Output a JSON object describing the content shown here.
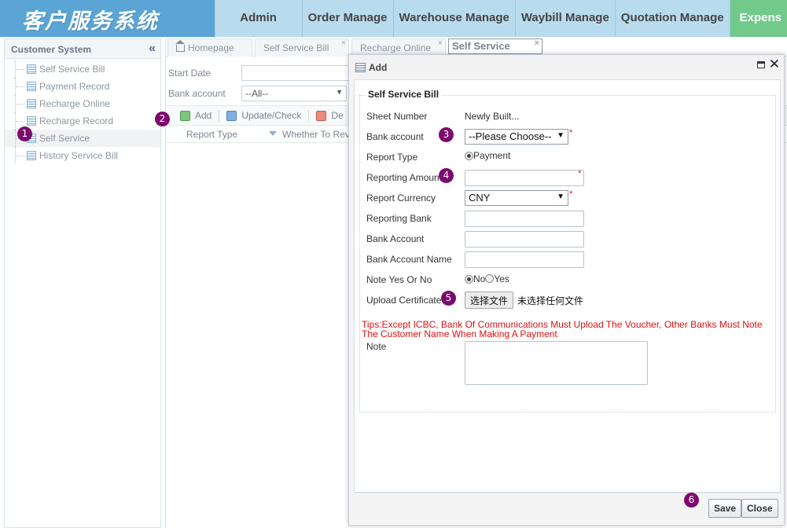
{
  "header": {
    "logo": "客户服务系统",
    "nav": [
      "Admin",
      "Order Manage",
      "Warehouse Manage",
      "Waybill Manage",
      "Quotation Manage",
      "Expens"
    ]
  },
  "sidebar": {
    "title": "Customer System",
    "items": [
      {
        "label": "Self Service Bill"
      },
      {
        "label": "Payment Record"
      },
      {
        "label": "Recharge Online"
      },
      {
        "label": "Recharge Record"
      },
      {
        "label": "Self Service"
      },
      {
        "label": "History Service Bill"
      }
    ]
  },
  "tabs": [
    "Homepage",
    "Self Service Bill",
    "Recharge Online",
    "Self Service"
  ],
  "filter": {
    "start_date_label": "Start Date",
    "bank_account_label": "Bank account",
    "bank_account_value": "--All--"
  },
  "toolbar": {
    "add": "Add",
    "update": "Update/Check",
    "delete": "De"
  },
  "grid": {
    "columns": [
      "Report Type",
      "Whether To Rev"
    ]
  },
  "dialog": {
    "title": "Add",
    "legend": "Self Service Bill",
    "sheet_number_label": "Sheet Number",
    "sheet_number_value": "Newly Built...",
    "bank_account_label": "Bank account",
    "bank_account_value": "--Please Choose--",
    "report_type_label": "Report Type",
    "report_type_value": "Payment",
    "reporting_amount_label": "Reporting Amount",
    "report_currency_label": "Report Currency",
    "report_currency_value": "CNY",
    "reporting_bank_label": "Reporting Bank",
    "bank_account2_label": "Bank Account",
    "bank_account_name_label": "Bank Account Name",
    "note_yes_no_label": "Note Yes Or No",
    "note_no": "No",
    "note_yes": "Yes",
    "upload_label": "Upload Certificate",
    "file_button": "选择文件",
    "file_status": "未选择任何文件",
    "tips_line1": "Tips:Except ICBC, Bank Of Communications Must Upload The Voucher, Other Banks Must Note",
    "tips_line2": "The Customer Name When Making A Payment",
    "note_label": "Note",
    "required_mark": "*",
    "save": "Save",
    "close": "Close"
  },
  "badges": [
    "1",
    "2",
    "3",
    "4",
    "5",
    "6"
  ]
}
